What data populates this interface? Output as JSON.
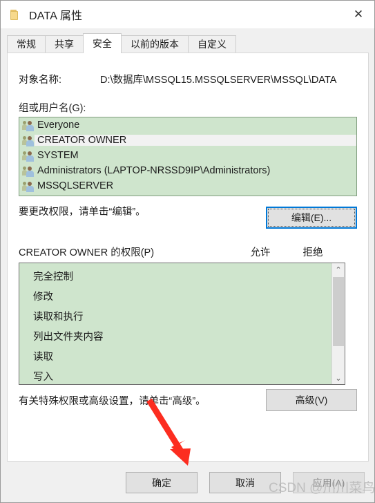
{
  "window": {
    "title": "DATA 属性",
    "icon": "folder-icon",
    "close_label": "✕"
  },
  "tabs": [
    {
      "label": "常规",
      "active": false
    },
    {
      "label": "共享",
      "active": false
    },
    {
      "label": "安全",
      "active": true
    },
    {
      "label": "以前的版本",
      "active": false
    },
    {
      "label": "自定义",
      "active": false
    }
  ],
  "security": {
    "object_name_label": "对象名称:",
    "object_name_value": "D:\\数据库\\MSSQL15.MSSQLSERVER\\MSSQL\\DATA",
    "group_label": "组或用户名(G):",
    "groups": [
      {
        "name": "Everyone",
        "selected": false
      },
      {
        "name": "CREATOR OWNER",
        "selected": true
      },
      {
        "name": "SYSTEM",
        "selected": false
      },
      {
        "name": "Administrators (LAPTOP-NRSSD9IP\\Administrators)",
        "selected": false
      },
      {
        "name": "MSSQLSERVER",
        "selected": false
      }
    ],
    "edit_hint": "要更改权限，请单击“编辑”。",
    "edit_button": "编辑(E)...",
    "permissions_title": "CREATOR OWNER 的权限(P)",
    "allow_column": "允许",
    "deny_column": "拒绝",
    "permissions": [
      "完全控制",
      "修改",
      "读取和执行",
      "列出文件夹内容",
      "读取",
      "写入"
    ],
    "advanced_hint": "有关特殊权限或高级设置，请单击“高级”。",
    "advanced_button": "高级(V)",
    "scrollbar": {
      "up_arrow": "⌃",
      "down_arrow": "⌄"
    }
  },
  "footer": {
    "ok": "确定",
    "cancel": "取消",
    "apply": "应用(A)"
  },
  "annotation": {
    "arrow_color": "#fc2d20"
  },
  "watermark": {
    "text": "CSDN @川川菜鸟"
  }
}
